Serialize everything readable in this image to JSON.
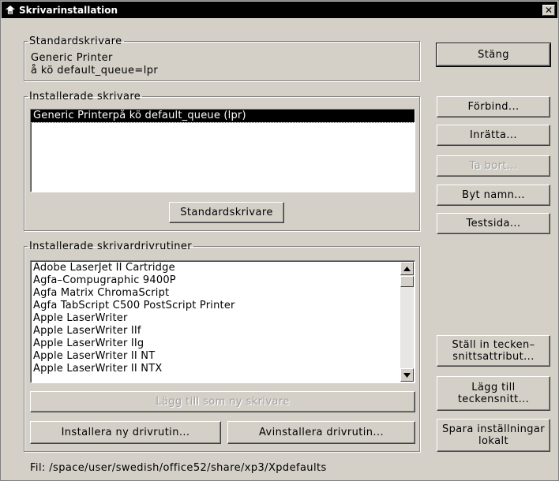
{
  "window": {
    "title": "Skrivarinstallation",
    "close_glyph": "✕"
  },
  "default_printer": {
    "legend": "Standardskrivare",
    "name": "Generic Printer",
    "queue": "å kö   default_queue=lpr"
  },
  "installed_printers": {
    "legend": "Installerade skrivare",
    "items": [
      "Generic Printerpå kö   default_queue (lpr)"
    ],
    "selected_index": 0,
    "set_default_label": "Standardskrivare"
  },
  "drivers": {
    "legend": "Installerade skrivardrivrutiner",
    "items": [
      "Adobe LaserJet II Cartridge",
      "Agfa–Compugraphic 9400P",
      "Agfa Matrix ChromaScript",
      "Agfa TabScript C500 PostScript Printer",
      "Apple LaserWriter",
      "Apple LaserWriter IIf",
      "Apple LaserWriter IIg",
      "Apple LaserWriter II NT",
      "Apple LaserWriter II NTX"
    ],
    "add_as_printer_label": "Lägg till som ny skrivare",
    "install_driver_label": "Installera ny drivrutin...",
    "uninstall_driver_label": "Avinstallera drivrutin..."
  },
  "side_buttons": {
    "close_label": "Stäng",
    "connect_label": "Förbind...",
    "setup_label": "Inrätta...",
    "remove_label": "Ta bort...",
    "rename_label": "Byt namn...",
    "test_page_label": "Testsida...",
    "font_attr_line1": "Ställ in tecken–",
    "font_attr_line2": "snittsattribut...",
    "add_font_line1": "Lägg till",
    "add_font_line2": "teckensnitt...",
    "save_local_line1": "Spara inställningar",
    "save_local_line2": "lokalt"
  },
  "file_path": "Fil:  /space/user/swedish/office52/share/xp3/Xpdefaults",
  "icons": {
    "app": "printer-icon",
    "close": "close-icon",
    "scroll_up": "arrow-up-icon",
    "scroll_down": "arrow-down-icon"
  },
  "colors": {
    "titlebar": "#000000",
    "face": "#d4d0c8",
    "selection": "#000000"
  }
}
